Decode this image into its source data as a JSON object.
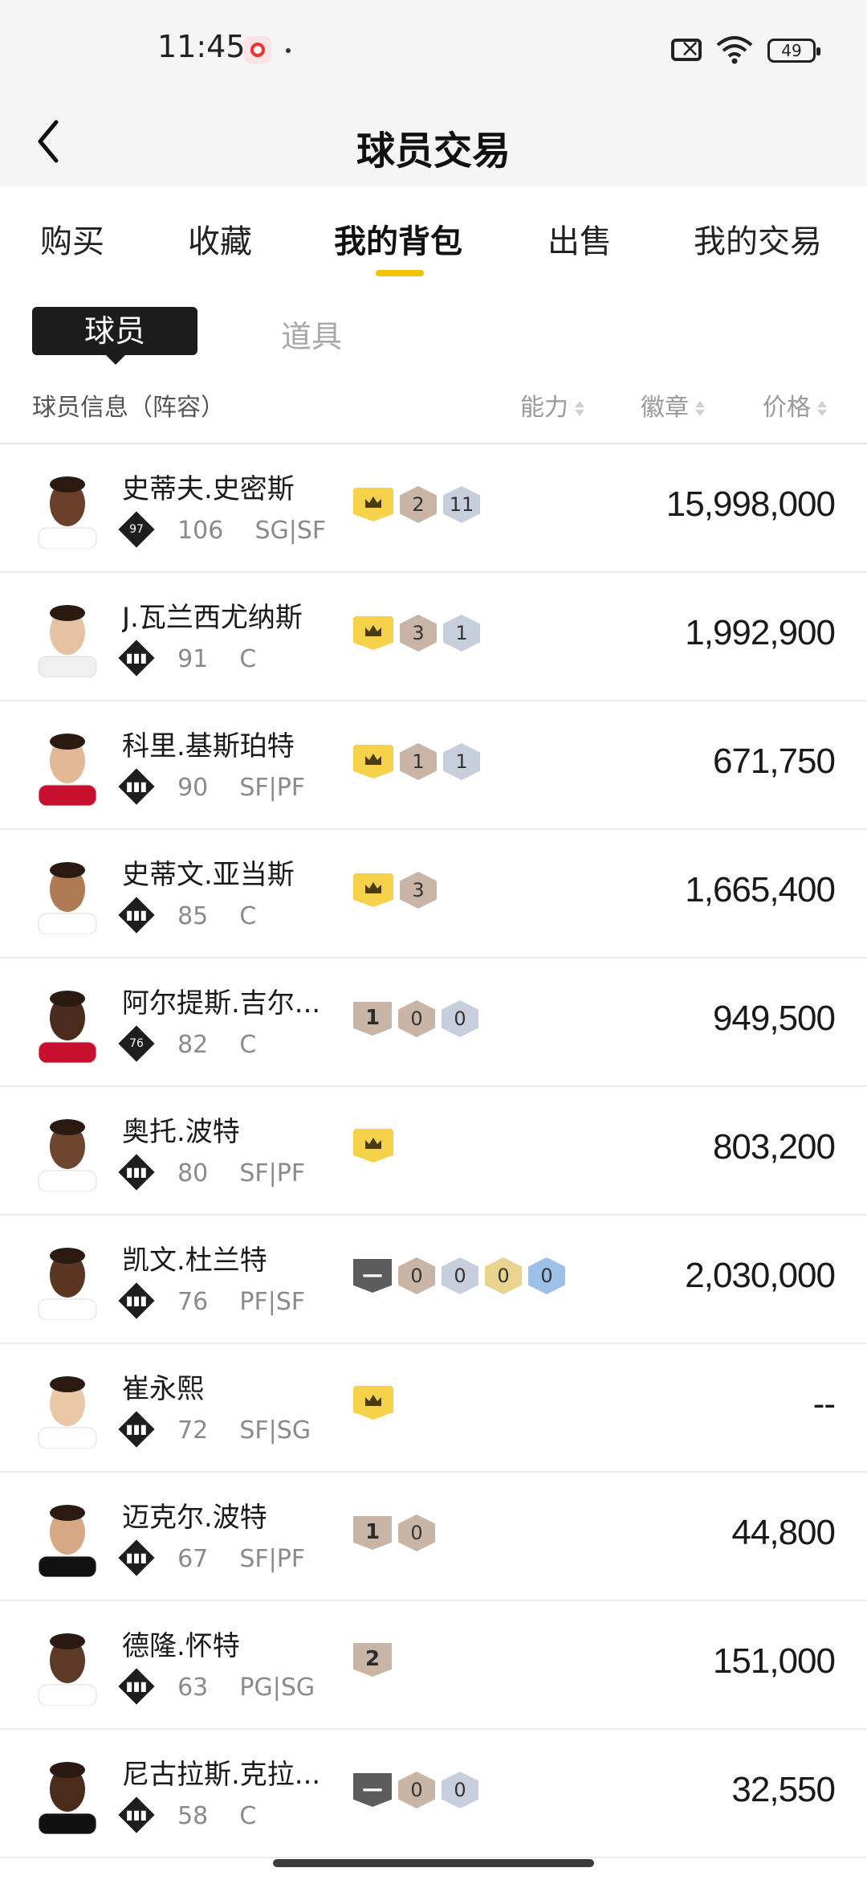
{
  "status": {
    "time": "11:45",
    "battery": "49"
  },
  "header": {
    "title": "球员交易"
  },
  "tabs": [
    {
      "label": "购买"
    },
    {
      "label": "收藏"
    },
    {
      "label": "我的背包"
    },
    {
      "label": "出售"
    },
    {
      "label": "我的交易"
    }
  ],
  "segment": {
    "active": "球员",
    "other": "道具"
  },
  "columns": {
    "info": "球员信息（阵容）",
    "ability": "能力",
    "badge": "徽章",
    "price": "价格"
  },
  "players": [
    {
      "name": "史蒂夫.史密斯",
      "tier": "97",
      "rating": "106",
      "pos": "SG|SF",
      "price": "15,998,000"
    },
    {
      "name": "J.瓦兰西尤纳斯",
      "tier": "",
      "rating": "91",
      "pos": "C",
      "price": "1,992,900"
    },
    {
      "name": "科里.基斯珀特",
      "tier": "",
      "rating": "90",
      "pos": "SF|PF",
      "price": "671,750"
    },
    {
      "name": "史蒂文.亚当斯",
      "tier": "",
      "rating": "85",
      "pos": "C",
      "price": "1,665,400"
    },
    {
      "name": "阿尔提斯.吉尔...",
      "tier": "76",
      "rating": "82",
      "pos": "C",
      "price": "949,500"
    },
    {
      "name": "奥托.波特",
      "tier": "",
      "rating": "80",
      "pos": "SF|PF",
      "price": "803,200"
    },
    {
      "name": "凯文.杜兰特",
      "tier": "",
      "rating": "76",
      "pos": "PF|SF",
      "price": "2,030,000"
    },
    {
      "name": "崔永熙",
      "tier": "",
      "rating": "72",
      "pos": "SF|SG",
      "price": "--"
    },
    {
      "name": "迈克尔.波特",
      "tier": "",
      "rating": "67",
      "pos": "SF|PF",
      "price": "44,800"
    },
    {
      "name": "德隆.怀特",
      "tier": "",
      "rating": "63",
      "pos": "PG|SG",
      "price": "151,000"
    },
    {
      "name": "尼古拉斯.克拉...",
      "tier": "",
      "rating": "58",
      "pos": "C",
      "price": "32,550"
    }
  ],
  "badges": [
    {
      "b1": "2",
      "b2": "11"
    },
    {
      "b1": "3",
      "b2": "1"
    },
    {
      "b1": "1",
      "b2": "1"
    },
    {
      "b1": "3"
    },
    {
      "s": "1",
      "b1": "0",
      "b2": "0"
    },
    {},
    {
      "b1": "0",
      "b2": "0",
      "b3": "0",
      "b4": "0"
    },
    {},
    {
      "s": "1",
      "b1": "0"
    },
    {
      "s": "2"
    },
    {
      "b1": "0",
      "b2": "0"
    }
  ],
  "colors": {
    "accent": "#f2c200",
    "crown": "#f6d14a",
    "segment_bg": "#1c1c1c"
  }
}
